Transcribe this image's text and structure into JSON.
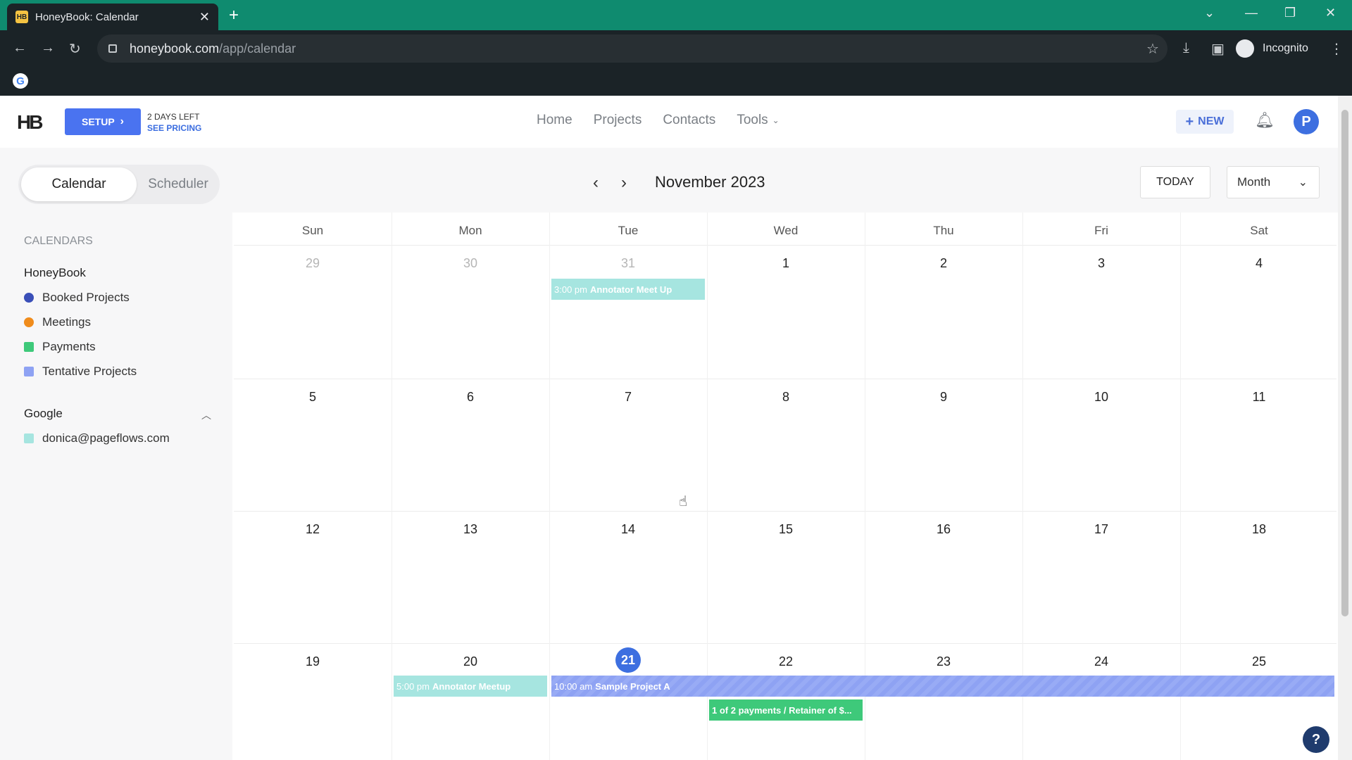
{
  "browser": {
    "tab_title": "HoneyBook: Calendar",
    "tab_favicon": "HB",
    "url_main": "honeybook.com",
    "url_path": "/app/calendar",
    "profile_label": "Incognito",
    "bookmark_icon": "G"
  },
  "header": {
    "logo": "HB",
    "setup_label": "SETUP",
    "trial_days": "2 DAYS LEFT",
    "trial_link": "SEE PRICING",
    "nav": [
      "Home",
      "Projects",
      "Contacts",
      "Tools"
    ],
    "new_label": "NEW",
    "avatar_initial": "P"
  },
  "toolbar": {
    "view_tabs": [
      "Calendar",
      "Scheduler"
    ],
    "active_view": "Calendar",
    "month_title": "November 2023",
    "today_label": "TODAY",
    "view_select": "Month"
  },
  "sidebar": {
    "heading": "CALENDARS",
    "groups": [
      {
        "name": "HoneyBook",
        "items": [
          {
            "label": "Booked Projects",
            "color": "#3a4fb8",
            "shape": "dot"
          },
          {
            "label": "Meetings",
            "color": "#f08c1c",
            "shape": "dot"
          },
          {
            "label": "Payments",
            "color": "#3ec97a",
            "shape": "square"
          },
          {
            "label": "Tentative Projects",
            "color": "#8ea2f3",
            "shape": "square"
          }
        ]
      },
      {
        "name": "Google",
        "items": [
          {
            "label": "donica@pageflows.com",
            "color": "#a6e5e0",
            "shape": "square"
          }
        ]
      }
    ]
  },
  "calendar": {
    "weekdays": [
      "Sun",
      "Mon",
      "Tue",
      "Wed",
      "Thu",
      "Fri",
      "Sat"
    ],
    "weeks": [
      [
        "29",
        "30",
        "31",
        "1",
        "2",
        "3",
        "4"
      ],
      [
        "5",
        "6",
        "7",
        "8",
        "9",
        "10",
        "11"
      ],
      [
        "12",
        "13",
        "14",
        "15",
        "16",
        "17",
        "18"
      ],
      [
        "19",
        "20",
        "21",
        "22",
        "23",
        "24",
        "25"
      ]
    ],
    "today": "21",
    "events": [
      {
        "time": "3:00 pm",
        "title": "Annotator Meet Up"
      },
      {
        "time": "5:00 pm",
        "title": "Annotator Meetup"
      },
      {
        "time": "10:00 am",
        "title": "Sample Project A"
      },
      {
        "time": "",
        "title": "1 of 2 payments / Retainer of $..."
      }
    ]
  }
}
